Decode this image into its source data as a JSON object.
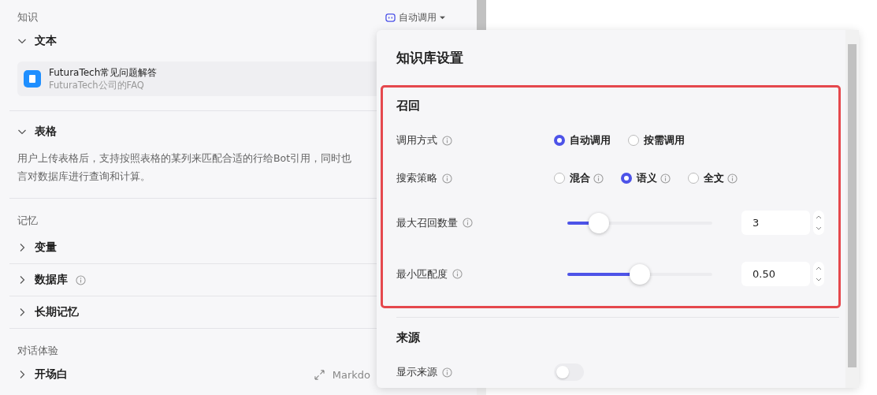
{
  "knowledge": {
    "title": "知识",
    "mode_button": "自动调用",
    "groups": [
      {
        "title": "文本",
        "expanded": true,
        "items": [
          {
            "name": "FuturaTech常见问题解答",
            "desc": "FuturaTech公司的FAQ"
          }
        ]
      },
      {
        "title": "表格",
        "expanded": true,
        "description_lines": [
          "用户上传表格后，支持按照表格的某列来匹配合适的行给Bot引用，同时也",
          "言对数据库进行查询和计算。"
        ]
      }
    ]
  },
  "memory": {
    "title": "记忆",
    "items": [
      {
        "label": "变量",
        "expanded": false,
        "info": false
      },
      {
        "label": "数据库",
        "expanded": false,
        "info": true
      },
      {
        "label": "长期记忆",
        "expanded": false,
        "info": false
      }
    ]
  },
  "dialog": {
    "title": "对话体验",
    "items": [
      {
        "label": "开场白",
        "expanded": false,
        "editor": "Markdo"
      }
    ]
  },
  "settings": {
    "title": "知识库设置",
    "recall": {
      "title": "召回",
      "rows": [
        {
          "kind": "radio",
          "label": "调用方式",
          "options": [
            {
              "label": "自动调用",
              "selected": true,
              "info": false
            },
            {
              "label": "按需调用",
              "selected": false,
              "info": false
            }
          ]
        },
        {
          "kind": "radio",
          "label": "搜索策略",
          "options": [
            {
              "label": "混合",
              "selected": false,
              "info": true
            },
            {
              "label": "语义",
              "selected": true,
              "info": true
            },
            {
              "label": "全文",
              "selected": false,
              "info": true
            }
          ]
        },
        {
          "kind": "slider",
          "label": "最大召回数量",
          "level": 0.22,
          "value": "3"
        },
        {
          "kind": "slider",
          "label": "最小匹配度",
          "level": 0.5,
          "value": "0.50"
        }
      ]
    },
    "source": {
      "title": "来源",
      "rows": [
        {
          "kind": "toggle",
          "label": "显示来源",
          "on": false
        }
      ]
    }
  }
}
